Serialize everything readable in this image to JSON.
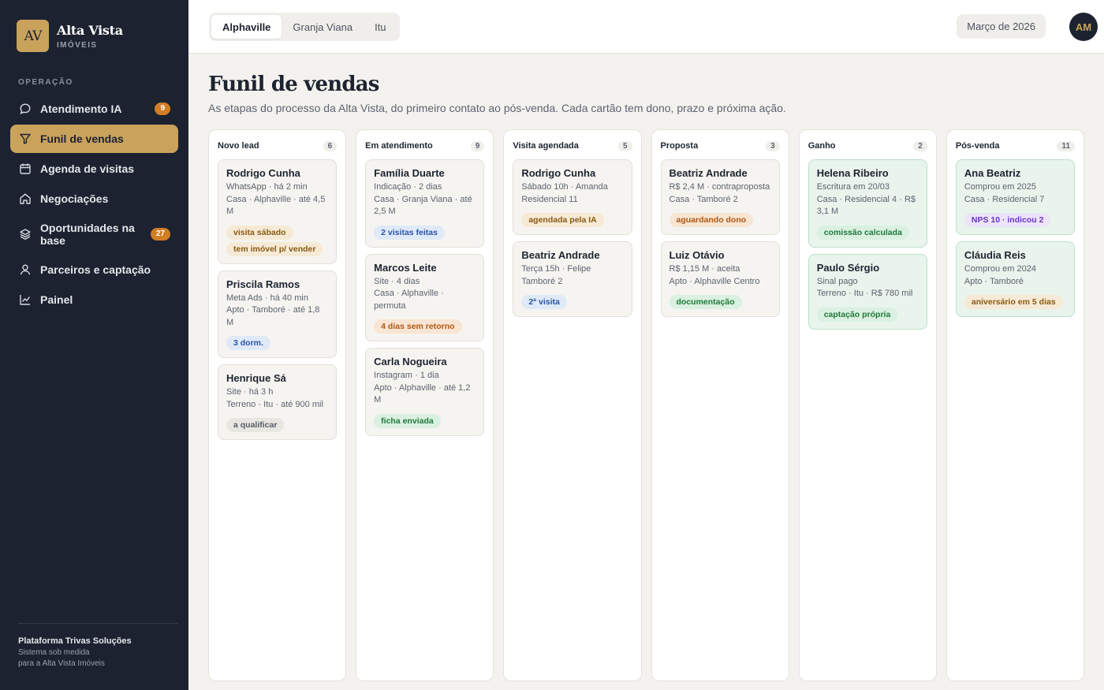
{
  "brand": {
    "logo": "AV",
    "name": "Alta Vista",
    "sub": "IMÓVEIS"
  },
  "sidebar": {
    "section": "OPERAÇÃO",
    "items": [
      {
        "label": "Atendimento IA",
        "icon": "chat-icon",
        "badge": "9"
      },
      {
        "label": "Funil de vendas",
        "icon": "filter-icon",
        "active": true
      },
      {
        "label": "Agenda de visitas",
        "icon": "calendar-icon"
      },
      {
        "label": "Negociações",
        "icon": "home-icon"
      },
      {
        "label": "Oportunidades na base",
        "icon": "layers-icon",
        "badge": "27"
      },
      {
        "label": "Parceiros e captação",
        "icon": "user-icon"
      },
      {
        "label": "Painel",
        "icon": "chart-icon"
      }
    ],
    "footer": {
      "title": "Plataforma Trivas Soluções",
      "line1": "Sistema sob medida",
      "line2": "para a Alta Vista Imóveis"
    }
  },
  "topbar": {
    "tabs": [
      "Alphaville",
      "Granja Viana",
      "Itu"
    ],
    "active_tab": "Alphaville",
    "period": "Março de 2026",
    "avatar": "AM"
  },
  "main": {
    "title": "Funil de vendas",
    "subtitle": "As etapas do processo da Alta Vista, do primeiro contato ao pós-venda. Cada cartão tem dono, prazo e próxima ação."
  },
  "colors": {
    "accent": "#c9a25c",
    "sidebar_bg": "#1c2230",
    "badge": "#d07d24"
  },
  "columns": [
    {
      "title": "Novo lead",
      "count": "6",
      "cards": [
        {
          "name": "Rodrigo Cunha",
          "lines": [
            "WhatsApp · há 2 min",
            "Casa · Alphaville · até 4,5 M"
          ],
          "tags": [
            {
              "text": "visita sábado",
              "tone": "amber"
            },
            {
              "text": "tem imóvel p/ vender",
              "tone": "amber"
            }
          ]
        },
        {
          "name": "Priscila Ramos",
          "lines": [
            "Meta Ads · há 40 min",
            "Apto · Tamboré · até 1,8 M"
          ],
          "tags": [
            {
              "text": "3 dorm.",
              "tone": "blue"
            }
          ]
        },
        {
          "name": "Henrique Sá",
          "lines": [
            "Site · há 3 h",
            "Terreno · Itu · até 900 mil"
          ],
          "tags": [
            {
              "text": "a qualificar",
              "tone": "gray"
            }
          ]
        }
      ]
    },
    {
      "title": "Em atendimento",
      "count": "9",
      "cards": [
        {
          "name": "Família Duarte",
          "lines": [
            "Indicação · 2 dias",
            "Casa · Granja Viana · até 2,5 M"
          ],
          "tags": [
            {
              "text": "2 visitas feitas",
              "tone": "blue"
            }
          ]
        },
        {
          "name": "Marcos Leite",
          "lines": [
            "Site · 4 dias",
            "Casa · Alphaville · permuta"
          ],
          "tags": [
            {
              "text": "4 dias sem retorno",
              "tone": "orange"
            }
          ]
        },
        {
          "name": "Carla Nogueira",
          "lines": [
            "Instagram · 1 dia",
            "Apto · Alphaville · até 1,2 M"
          ],
          "tags": [
            {
              "text": "ficha enviada",
              "tone": "green"
            }
          ]
        }
      ]
    },
    {
      "title": "Visita agendada",
      "count": "5",
      "cards": [
        {
          "name": "Rodrigo Cunha",
          "lines": [
            "Sábado 10h · Amanda",
            "Residencial 11"
          ],
          "tags": [
            {
              "text": "agendada pela IA",
              "tone": "amber"
            }
          ]
        },
        {
          "name": "Beatriz Andrade",
          "lines": [
            "Terça 15h · Felipe",
            "Tamboré 2"
          ],
          "tags": [
            {
              "text": "2ª visita",
              "tone": "blue"
            }
          ]
        }
      ]
    },
    {
      "title": "Proposta",
      "count": "3",
      "cards": [
        {
          "name": "Beatriz Andrade",
          "lines": [
            "R$ 2,4 M · contraproposta",
            "Casa · Tamboré 2"
          ],
          "tags": [
            {
              "text": "aguardando dono",
              "tone": "orange"
            }
          ]
        },
        {
          "name": "Luiz Otávio",
          "lines": [
            "R$ 1,15 M · aceita",
            "Apto · Alphaville Centro"
          ],
          "tags": [
            {
              "text": "documentação",
              "tone": "green"
            }
          ]
        }
      ]
    },
    {
      "title": "Ganho",
      "count": "2",
      "green": true,
      "cards": [
        {
          "name": "Helena Ribeiro",
          "lines": [
            "Escritura em 20/03",
            "Casa · Residencial 4 · R$ 3,1 M"
          ],
          "tags": [
            {
              "text": "comissão calculada",
              "tone": "green"
            }
          ]
        },
        {
          "name": "Paulo Sérgio",
          "lines": [
            "Sinal pago",
            "Terreno · Itu · R$ 780 mil"
          ],
          "tags": [
            {
              "text": "captação própria",
              "tone": "green"
            }
          ]
        }
      ]
    },
    {
      "title": "Pós-venda",
      "count": "11",
      "green": true,
      "cards": [
        {
          "name": "Ana Beatriz",
          "lines": [
            "Comprou em 2025",
            "Casa · Residencial 7"
          ],
          "tags": [
            {
              "text": "NPS 10 · indicou 2",
              "tone": "purple"
            }
          ]
        },
        {
          "name": "Cláudia Reis",
          "lines": [
            "Comprou em 2024",
            "Apto · Tamboré"
          ],
          "tags": [
            {
              "text": "aniversário em 5 dias",
              "tone": "amber"
            }
          ]
        }
      ]
    }
  ]
}
